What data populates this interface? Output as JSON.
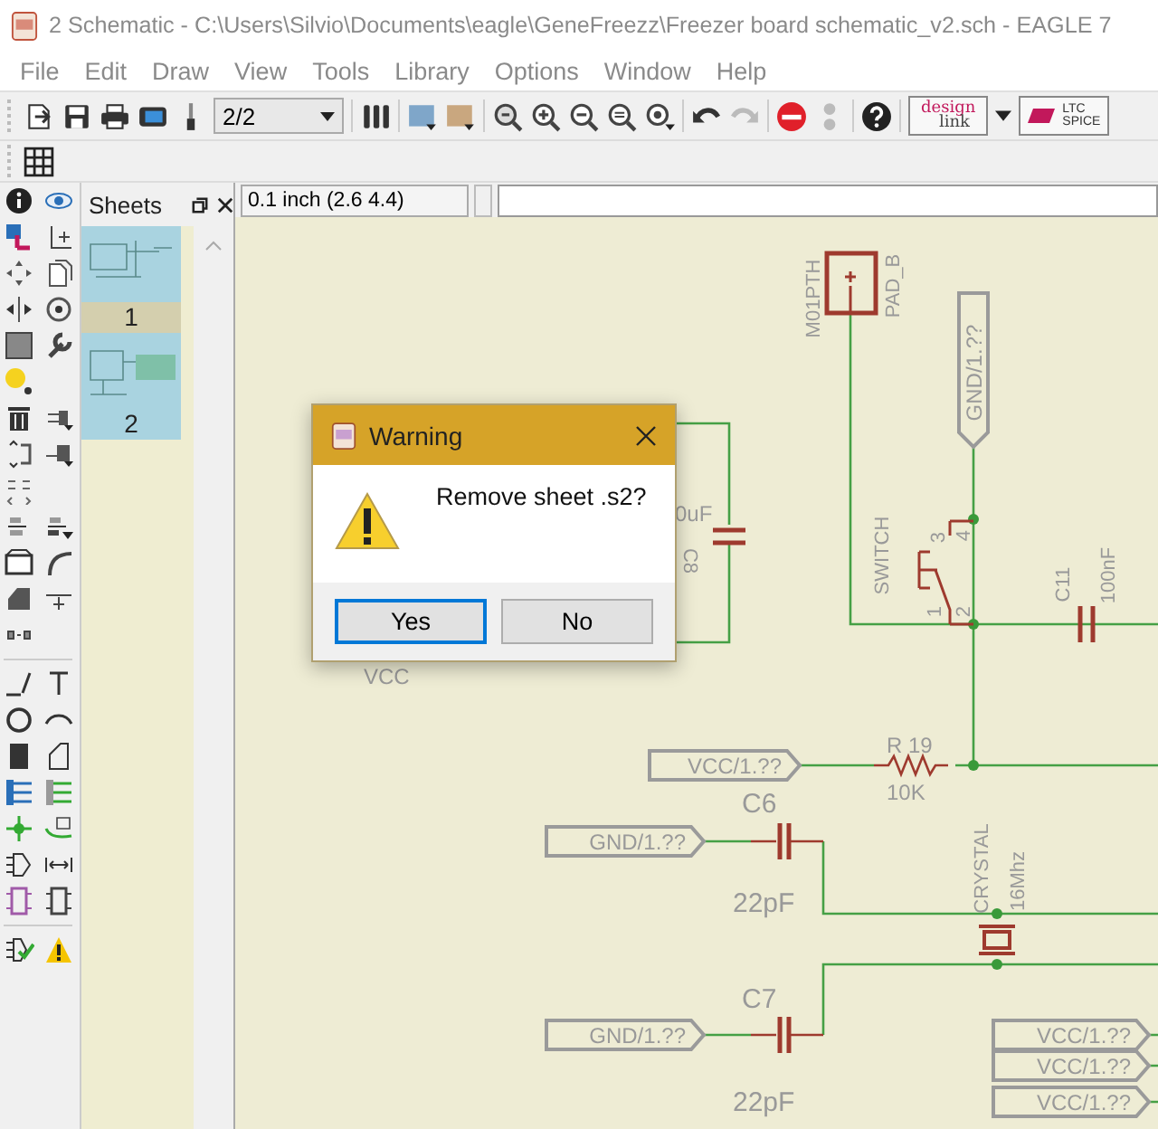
{
  "window": {
    "title": "2 Schematic - C:\\Users\\Silvio\\Documents\\eagle\\GeneFreezz\\Freezer board schematic_v2.sch - EAGLE 7"
  },
  "menu": [
    "File",
    "Edit",
    "Draw",
    "View",
    "Tools",
    "Library",
    "Options",
    "Window",
    "Help"
  ],
  "toolbar": {
    "sheet_select": "2/2",
    "design_link": [
      "design",
      "link"
    ],
    "spice": [
      "LTC",
      "SPICE"
    ]
  },
  "sheets_panel": {
    "title": "Sheets",
    "sheets": [
      {
        "label": "1",
        "selected": false
      },
      {
        "label": "2",
        "selected": true
      }
    ]
  },
  "command_bar": {
    "coordinates": "0.1 inch (2.6 4.4)"
  },
  "schematic": {
    "texts": [
      {
        "text": "M01PTH",
        "kind": "vertical"
      },
      {
        "text": "PAD_B",
        "kind": "vertical"
      },
      {
        "text": "0uF",
        "kind": "horizontal"
      },
      {
        "text": "C8",
        "kind": "vertical-down"
      },
      {
        "text": "SWITCH",
        "kind": "vertical"
      },
      {
        "text": "3",
        "kind": "vertical"
      },
      {
        "text": "4",
        "kind": "vertical"
      },
      {
        "text": "1",
        "kind": "vertical"
      },
      {
        "text": "2",
        "kind": "vertical"
      },
      {
        "text": "C11",
        "kind": "vertical"
      },
      {
        "text": "100nF",
        "kind": "vertical"
      },
      {
        "text": "VCC",
        "kind": "horizontal"
      },
      {
        "text": "R 19",
        "kind": "horizontal"
      },
      {
        "text": "10K",
        "kind": "horizontal"
      },
      {
        "text": "C6",
        "kind": "large"
      },
      {
        "text": "22pF",
        "kind": "large"
      },
      {
        "text": "CRYSTAL",
        "kind": "vertical"
      },
      {
        "text": "16Mhz",
        "kind": "vertical"
      },
      {
        "text": "C7",
        "kind": "large"
      },
      {
        "text": "22pF",
        "kind": "large"
      }
    ],
    "net_labels": [
      {
        "text": "GND/1.??",
        "kind": "down"
      },
      {
        "text": "VCC/1.??",
        "kind": "right"
      },
      {
        "text": "GND/1.??",
        "kind": "right"
      },
      {
        "text": "GND/1.??",
        "kind": "right"
      },
      {
        "text": "VCC/1.??",
        "kind": "right"
      },
      {
        "text": "VCC/1.??",
        "kind": "right"
      },
      {
        "text": "VCC/1.??",
        "kind": "right"
      }
    ]
  },
  "dialog": {
    "title": "Warning",
    "message": "Remove sheet .s2?",
    "buttons": [
      {
        "label": "Yes",
        "selected": true
      },
      {
        "label": "No",
        "selected": false
      }
    ]
  }
}
